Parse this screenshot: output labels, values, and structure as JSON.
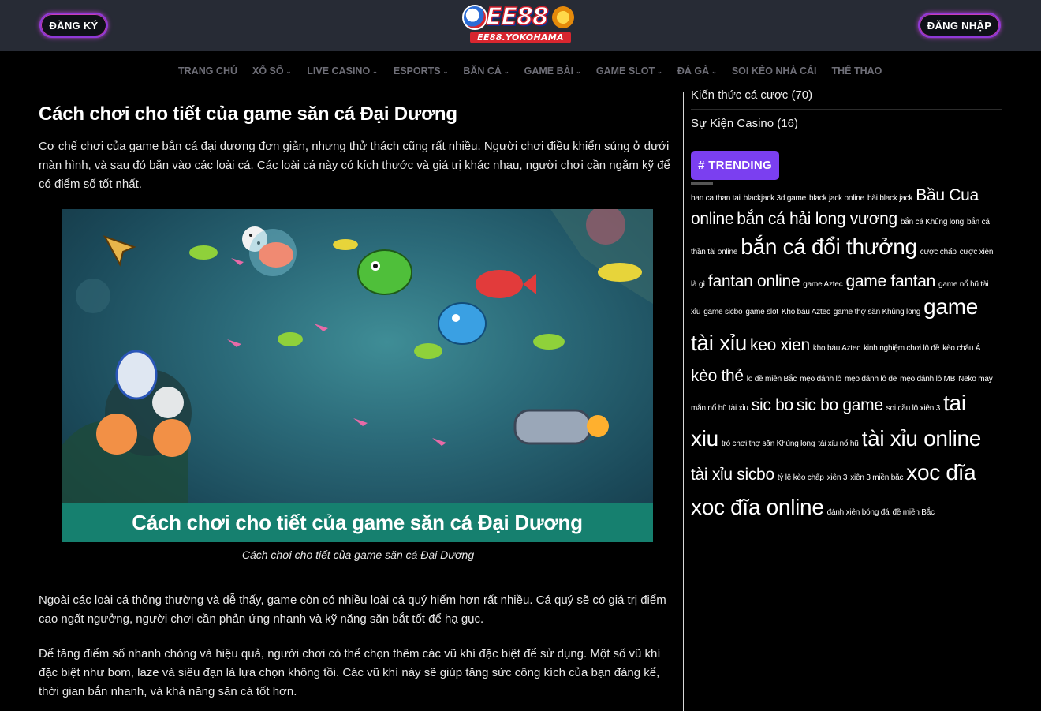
{
  "header": {
    "register_label": "ĐĂNG KÝ",
    "login_label": "ĐĂNG NHẬP",
    "logo_text": "EE88",
    "logo_sub": "EE88.YOKOHAMA"
  },
  "nav": {
    "items": [
      {
        "label": "TRANG CHỦ",
        "has_dropdown": false
      },
      {
        "label": "XỔ SỐ",
        "has_dropdown": true
      },
      {
        "label": "LIVE CASINO",
        "has_dropdown": true
      },
      {
        "label": "ESPORTS",
        "has_dropdown": true
      },
      {
        "label": "BẮN CÁ",
        "has_dropdown": true
      },
      {
        "label": "GAME BÀI",
        "has_dropdown": true
      },
      {
        "label": "GAME SLOT",
        "has_dropdown": true
      },
      {
        "label": "ĐÁ GÀ",
        "has_dropdown": true
      },
      {
        "label": "SOI KÈO NHÀ CÁI",
        "has_dropdown": false
      },
      {
        "label": "THỂ THAO",
        "has_dropdown": false
      }
    ]
  },
  "article": {
    "heading": "Cách chơi cho tiết của game săn cá Đại Dương",
    "para1": "Cơ chế chơi của game bắn cá đại dương đơn giản, nhưng thử thách cũng rất nhiều. Người chơi điều khiển súng ở dưới màn hình, và sau đó bắn vào các loài cá. Các loài cá này có kích thước và giá trị khác nhau, người chơi cần ngắm kỹ để có điểm số tốt nhất.",
    "image_banner": "Cách chơi cho tiết của game săn cá Đại Dương",
    "caption": "Cách chơi cho tiết của game săn cá Đại Dương",
    "para2": "Ngoài các loài cá thông thường và dễ thấy, game còn có nhiều loài cá quý hiếm hơn rất nhiều. Cá quý sẽ có giá trị điểm cao ngất ngưởng, người chơi cần phản ứng nhanh và kỹ năng săn bắt tốt để hạ gục.",
    "para3": "Để tăng điểm số nhanh chóng và hiệu quả, người chơi có thể chọn thêm các vũ khí đặc biệt để sử dụng. Một số vũ khí đặc biệt như bom, laze và siêu đạn là lựa chọn không tồi. Các vũ khí này sẽ giúp tăng sức công kích của bạn đáng kể, thời gian bắn nhanh, và khả năng săn cá tốt hơn."
  },
  "sidebar": {
    "categories": [
      {
        "label": "Kiến thức cá cược (70)"
      },
      {
        "label": "Sự Kiện Casino (16)"
      }
    ],
    "trending_label": "# TRENDING",
    "tag_lines": [
      [
        {
          "t": "ban ca than tai",
          "s": 10
        },
        {
          "t": "blackjack 3d game",
          "s": 10
        },
        {
          "t": "black jack online",
          "s": 10
        },
        {
          "t": "bài black jack",
          "s": 10
        },
        {
          "t": "Bầu Cua",
          "s": 21
        }
      ],
      [
        {
          "t": "online",
          "s": 21
        },
        {
          "t": "bắn cá hải long vương",
          "s": 21
        },
        {
          "t": "bắn cá Khủng long",
          "s": 10
        },
        {
          "t": "bắn cá",
          "s": 10
        }
      ],
      [
        {
          "t": "thần tài online",
          "s": 10
        },
        {
          "t": "bắn cá đổi thưởng",
          "s": 28
        },
        {
          "t": "cược chấp",
          "s": 10
        },
        {
          "t": "cược xiên",
          "s": 10
        }
      ],
      [
        {
          "t": "là gì",
          "s": 10
        },
        {
          "t": "fantan online",
          "s": 21
        },
        {
          "t": "game Aztec",
          "s": 10
        },
        {
          "t": "game fantan",
          "s": 21
        },
        {
          "t": "game nổ hũ tài",
          "s": 10
        }
      ],
      [
        {
          "t": "xỉu",
          "s": 10
        },
        {
          "t": "game sicbo",
          "s": 10
        },
        {
          "t": "game slot",
          "s": 10
        },
        {
          "t": "Kho báu Aztec",
          "s": 10
        },
        {
          "t": "game thợ săn Khủng long",
          "s": 10
        },
        {
          "t": "game",
          "s": 28
        }
      ],
      [
        {
          "t": "tài xỉu",
          "s": 28
        },
        {
          "t": "keo xien",
          "s": 21
        },
        {
          "t": "kho báu Aztec",
          "s": 10
        },
        {
          "t": "kinh nghiệm chơi lô đề",
          "s": 10
        },
        {
          "t": "kèo châu Á",
          "s": 10
        }
      ],
      [
        {
          "t": "kèo thẻ",
          "s": 21
        },
        {
          "t": "lo đề miền Bắc",
          "s": 10
        },
        {
          "t": "mẹo đánh lô",
          "s": 10
        },
        {
          "t": "mẹo đánh lô de",
          "s": 10
        },
        {
          "t": "mẹo đánh lô MB",
          "s": 10
        },
        {
          "t": "Neko may",
          "s": 10
        }
      ],
      [
        {
          "t": "mắn nổ hũ tài xỉu",
          "s": 10
        },
        {
          "t": "sic bo",
          "s": 21
        },
        {
          "t": "sic bo game",
          "s": 21
        },
        {
          "t": "soi cầu lô xiên 3",
          "s": 10
        },
        {
          "t": "tai",
          "s": 28
        }
      ],
      [
        {
          "t": "xiu",
          "s": 28
        },
        {
          "t": "trò chơi thợ săn Khủng long",
          "s": 10
        },
        {
          "t": "tài xỉu nổ hũ",
          "s": 10
        },
        {
          "t": "tài xỉu online",
          "s": 28
        }
      ],
      [
        {
          "t": "tài xỉu sicbo",
          "s": 21
        },
        {
          "t": "tỷ lệ kèo chấp",
          "s": 10
        },
        {
          "t": "xiên 3",
          "s": 10
        },
        {
          "t": "xiên 3 miền bắc",
          "s": 10
        },
        {
          "t": "xoc dĩa",
          "s": 28
        }
      ],
      [
        {
          "t": "xoc đĩa online",
          "s": 28
        },
        {
          "t": "đánh xiên bóng đá",
          "s": 10
        },
        {
          "t": "đề miền Bắc",
          "s": 10
        }
      ]
    ]
  },
  "colors": {
    "header_bg": "#272b35",
    "trending_bg": "#7b3ff0",
    "banner_bg": "#16806f",
    "pill_border": "#8f3ad8"
  }
}
